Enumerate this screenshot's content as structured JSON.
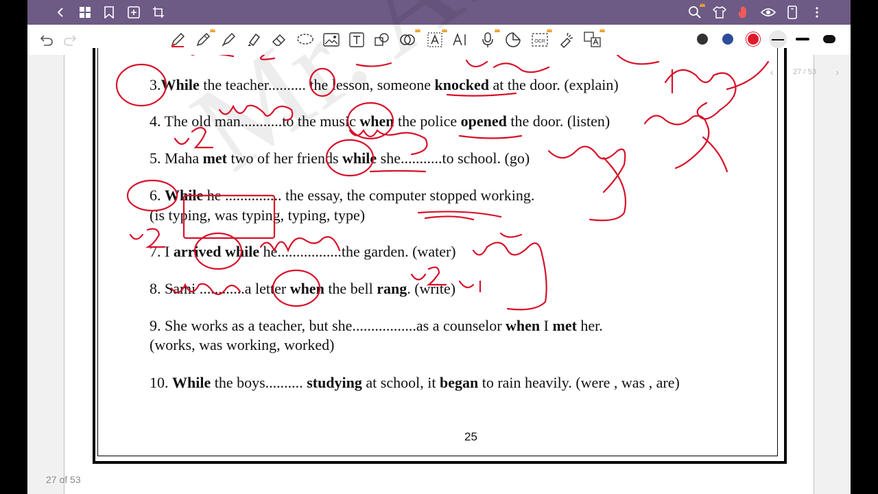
{
  "topbar": {
    "icons": [
      "back-icon",
      "grid-icon",
      "bookmark-icon",
      "add-page-icon",
      "crop-icon",
      "search-icon",
      "shirt-icon",
      "hand-icon",
      "eye-icon",
      "phone-icon",
      "more-icon"
    ]
  },
  "toolbar": {
    "colors": [
      "#333333",
      "#2c4c9b",
      "#e0192c"
    ]
  },
  "document": {
    "lines": {
      "l3": {
        "n": "3.",
        "w1": "While",
        "t1": " the teacher.......... the lesson, someone ",
        "w2": "knocked",
        "t2": " at the door. (explain)"
      },
      "l4": {
        "t1": "4. The old man...........to the music ",
        "w1": "when",
        "t2": " the police ",
        "w2": "opened",
        "t3": " the door.  (listen)"
      },
      "l5": {
        "t1": "5. Maha ",
        "w1": "met",
        "t2": " two of her friends ",
        "w2": "while",
        "t3": " she...........to school. (go)"
      },
      "l6a": {
        "t1": "6. ",
        "w1": "While",
        "t2": " he ............... the essay, the computer stopped working."
      },
      "l6b": {
        "t1": "(is typing, was typing, typing, type)"
      },
      "l7": {
        "t1": "7. I ",
        "w1": "arrived",
        "t2": " ",
        "w2": "while",
        "t3": " he.................the garden. (water)"
      },
      "l8": {
        "t1": "8. Sami ............a letter ",
        "w1": "when",
        "t2": " the bell ",
        "w2": "rang",
        "t3": ". (write)"
      },
      "l9a": {
        "t1": "9. She works as a teacher, but she.................as a counselor ",
        "w1": "when",
        "t2": " I ",
        "w2": "met",
        "t3": " her."
      },
      "l9b": {
        "t1": " (works, was working, worked)"
      },
      "l10": {
        "t1": "10. ",
        "w1": "While",
        "t2": " the boys.......... ",
        "w2": "studying",
        "t3": " at school, it ",
        "w3": "began",
        "t4": " to rain heavily. (were , was , are)"
      }
    },
    "page_number": "25",
    "pager_label": "27 / 53",
    "page_count_label": "27 of 53"
  }
}
